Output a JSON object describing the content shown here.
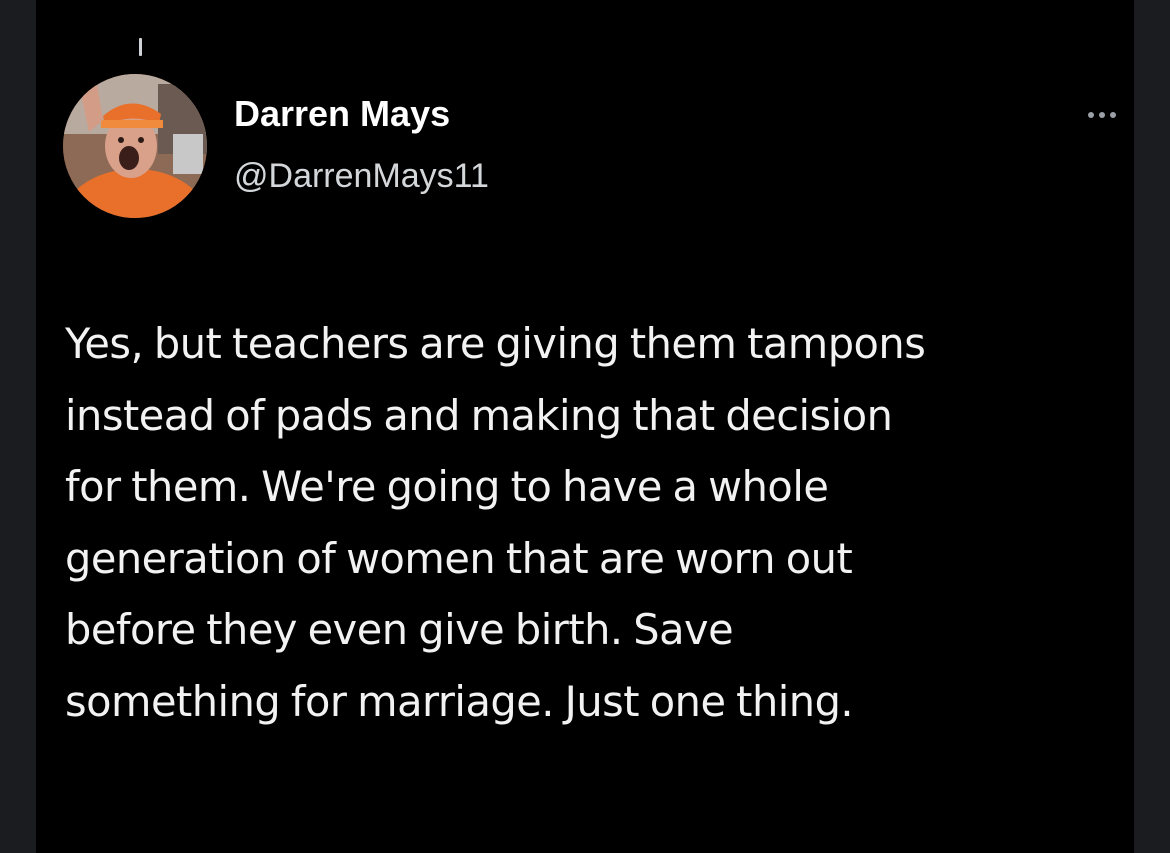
{
  "tweet": {
    "display_name": "Darren Mays",
    "handle": "@DarrenMays11",
    "more_icon": "more-horizontal-icon",
    "avatar_icon": "profile-photo-avatar",
    "text_lines": [
      "Yes, but teachers are giving them tampons",
      "instead of pads and making that decision",
      "for them. We're going to have a whole",
      "generation of women that are worn out",
      "before they even give birth.  Save",
      "something for marriage. Just one thing."
    ]
  },
  "colors": {
    "background": "#000000",
    "side_margin": "#1a1c20",
    "text": "#f2f2f2",
    "secondary_text": "#d4d7da"
  }
}
